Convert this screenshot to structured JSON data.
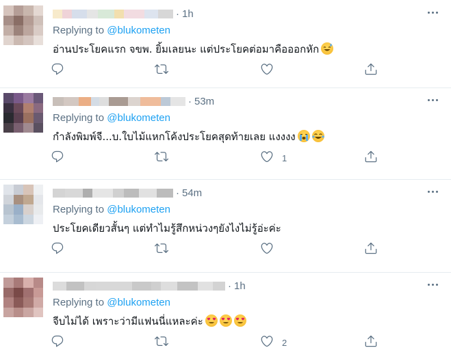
{
  "replies": [
    {
      "time": "1h",
      "replying_prefix": "Replying to ",
      "handle": "@blukometen",
      "text": "อ่านประโยคแรก จขพ. ยิ้มเลยนะ แต่ประโยคต่อมาคือออกหัก",
      "emojis": [
        "grinning-sweat-emoji"
      ],
      "likes": "",
      "avatar_colors": [
        "#d6c4bd",
        "#b59e97",
        "#c8b6ad",
        "#e4d8d2",
        "#a78f88",
        "#8a6e66",
        "#b49c94",
        "#cfc0b9",
        "#c2aea6",
        "#9c837b",
        "#bca69e",
        "#d9cbc5",
        "#e0d4ce",
        "#cbb9b1",
        "#d4c5bf",
        "#e8dfda"
      ],
      "name_colors": [
        "#f0d9a0",
        "#e8c0c8",
        "#cfd8e8",
        "#d0d0d0",
        "#c8e0c8"
      ]
    },
    {
      "time": "53m",
      "replying_prefix": "Replying to ",
      "handle": "@blukometen",
      "text": "กำลังพิมพ์จี...บ.ใบไม้แหกโค้งประโยคสุดท้ายเลย แงงงง",
      "emojis": [
        "loudly-crying-emoji",
        "tears-of-joy-emoji"
      ],
      "likes": "1",
      "avatar_colors": [
        "#5a4a6a",
        "#7a5a8a",
        "#9a7aa0",
        "#6a5878",
        "#3a3040",
        "#6a4a5a",
        "#b08070",
        "#8a6a80",
        "#2a2a30",
        "#5a4050",
        "#9a7060",
        "#6a5a70",
        "#4a4048",
        "#7a6070",
        "#a08a90",
        "#5a5060"
      ],
      "name_colors": [
        "#9a8a80",
        "#c0b0a8",
        "#e8a070",
        "#b0c0d0",
        "#d0d0d0"
      ]
    },
    {
      "time": "54m",
      "replying_prefix": "Replying to ",
      "handle": "@blukometen",
      "text": "ประโยคเดียวสั้นๆ แต่ทำไมรู้สึกหน่วงๆยังไงไม่รู้อ่ะค่ะ",
      "emojis": [],
      "likes": "",
      "avatar_colors": [
        "#e0e4ea",
        "#c8ccd4",
        "#d8c4b8",
        "#eef0f2",
        "#d0d4da",
        "#a89080",
        "#c0a890",
        "#e4e6ea",
        "#b8c4d0",
        "#9ab0c8",
        "#d8d0cc",
        "#e8eaec",
        "#c4d0dc",
        "#a8bcd0",
        "#ccd6e0",
        "#eef0f4"
      ],
      "name_colors": [
        "#b0b0b0",
        "#c8c8c8",
        "#a0a0a0",
        "#d0d0d0",
        "#bcbcbc"
      ]
    },
    {
      "time": "1h",
      "replying_prefix": "Replying to ",
      "handle": "@blukometen",
      "text": "จีบไม่ได้ เพราะว่ามีแฟนนี่แหละค่ะ",
      "emojis": [
        "heart-eyes-emoji",
        "heart-eyes-emoji",
        "heart-eyes-emoji"
      ],
      "likes": "2",
      "avatar_colors": [
        "#c09a98",
        "#a87a78",
        "#d8b0ac",
        "#b88a88",
        "#986a68",
        "#7a4a48",
        "#a07070",
        "#c89a96",
        "#b08280",
        "#8a5a58",
        "#a87a76",
        "#d0aaa6",
        "#c8a4a0",
        "#b88e8a",
        "#caa6a2",
        "#e0c4c0"
      ],
      "name_colors": [
        "#c0c0c0",
        "#a8a8a8",
        "#d0d0d0",
        "#b8b8b8",
        "#c8c8c8"
      ]
    }
  ],
  "colors": {
    "accent": "#1da1f2",
    "muted": "#5b7083",
    "divider": "#e6ecf0"
  }
}
